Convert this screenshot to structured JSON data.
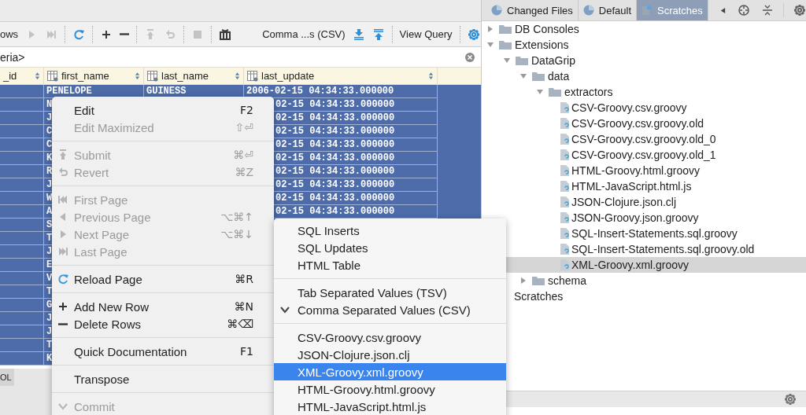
{
  "toolbar": {
    "items": [
      {
        "kind": "text",
        "label": "ows"
      },
      {
        "kind": "next",
        "disabled": true
      },
      {
        "kind": "last",
        "disabled": true
      },
      {
        "kind": "sep"
      },
      {
        "kind": "reload",
        "disabled": false
      },
      {
        "kind": "sep"
      },
      {
        "kind": "add",
        "disabled": false
      },
      {
        "kind": "delete",
        "disabled": false
      },
      {
        "kind": "sep"
      },
      {
        "kind": "submit",
        "disabled": true
      },
      {
        "kind": "revert",
        "disabled": true
      },
      {
        "kind": "sep"
      },
      {
        "kind": "stop",
        "disabled": true
      },
      {
        "kind": "sep"
      },
      {
        "kind": "compare",
        "disabled": false
      },
      {
        "kind": "dropdown",
        "label": "Comma ...s (CSV)"
      },
      {
        "kind": "download",
        "disabled": false
      },
      {
        "kind": "upload",
        "disabled": false
      },
      {
        "kind": "sep"
      },
      {
        "kind": "text",
        "label": "View Query"
      },
      {
        "kind": "sep"
      },
      {
        "kind": "settings",
        "disabled": false
      }
    ]
  },
  "filter": {
    "placeholder": "eria>"
  },
  "table": {
    "columns": [
      "_id",
      "first_name",
      "last_name",
      "last_update"
    ],
    "rows": [
      {
        "selected": true,
        "first_name": "PENELOPE",
        "last_name": "GUINESS",
        "last_update": "2006-02-15 04:34:33.000000"
      },
      {
        "selected": true,
        "first_name": "N",
        "last_update": "02-15 04:34:33.000000"
      },
      {
        "selected": true,
        "first_name": "J",
        "last_update": "02-15 04:34:33.000000"
      },
      {
        "selected": true,
        "first_name": "C",
        "last_update": "02-15 04:34:33.000000"
      },
      {
        "selected": true,
        "first_name": "C",
        "last_update": "02-15 04:34:33.000000"
      },
      {
        "selected": true,
        "first_name": "K",
        "last_update": "02-15 04:34:33.000000"
      },
      {
        "selected": true,
        "first_name": "R",
        "last_update": "02-15 04:34:33.000000"
      },
      {
        "selected": true,
        "first_name": "J",
        "last_update": "02-15 04:34:33.000000"
      },
      {
        "selected": true,
        "first_name": "W",
        "last_update": "02-15 04:34:33.000000"
      },
      {
        "selected": true,
        "first_name": "A",
        "last_update": "02-15 04:34:33.000000"
      },
      {
        "selected": true,
        "first_name": "S"
      },
      {
        "selected": true,
        "first_name": "T"
      },
      {
        "selected": true,
        "first_name": "J"
      },
      {
        "selected": true,
        "first_name": "E"
      },
      {
        "selected": true,
        "first_name": "V"
      },
      {
        "selected": true,
        "first_name": "T"
      },
      {
        "selected": true,
        "first_name": "G"
      },
      {
        "selected": true,
        "first_name": "J"
      },
      {
        "selected": true,
        "first_name": "J"
      },
      {
        "selected": true,
        "first_name": "T"
      },
      {
        "selected": true,
        "first_name": "K"
      }
    ]
  },
  "bottom_tab": {
    "label": "OL"
  },
  "right_panel": {
    "tabs": [
      {
        "label": "Changed Files",
        "selected": false,
        "kind": "changes"
      },
      {
        "label": "Default",
        "selected": false,
        "kind": "changes"
      },
      {
        "label": "Scratches",
        "selected": true,
        "kind": "scratches"
      }
    ],
    "tree": [
      {
        "label": "DB Consoles",
        "kind": "folder",
        "expanded": false
      },
      {
        "label": "Extensions",
        "kind": "folder",
        "expanded": true,
        "children": [
          {
            "label": "DataGrip",
            "kind": "folder",
            "expanded": true,
            "children": [
              {
                "label": "data",
                "kind": "folder",
                "expanded": true,
                "children": [
                  {
                    "label": "extractors",
                    "kind": "folder",
                    "expanded": true,
                    "children": [
                      {
                        "label": "CSV-Groovy.csv.groovy",
                        "kind": "file",
                        "selected": false
                      },
                      {
                        "label": "CSV-Groovy.csv.groovy.old",
                        "kind": "file",
                        "selected": false
                      },
                      {
                        "label": "CSV-Groovy.csv.groovy.old_0",
                        "kind": "file",
                        "selected": false
                      },
                      {
                        "label": "CSV-Groovy.csv.groovy.old_1",
                        "kind": "file",
                        "selected": false
                      },
                      {
                        "label": "HTML-Groovy.html.groovy",
                        "kind": "file",
                        "selected": false
                      },
                      {
                        "label": "HTML-JavaScript.html.js",
                        "kind": "file",
                        "selected": false
                      },
                      {
                        "label": "JSON-Clojure.json.clj",
                        "kind": "file",
                        "selected": false
                      },
                      {
                        "label": "JSON-Groovy.json.groovy",
                        "kind": "file",
                        "selected": false
                      },
                      {
                        "label": "SQL-Insert-Statements.sql.groovy",
                        "kind": "file",
                        "selected": false
                      },
                      {
                        "label": "SQL-Insert-Statements.sql.groovy.old",
                        "kind": "file",
                        "selected": false
                      },
                      {
                        "label": "XML-Groovy.xml.groovy",
                        "kind": "file",
                        "selected": true
                      }
                    ]
                  }
                ]
              },
              {
                "label": "schema",
                "kind": "folder",
                "expanded": false
              }
            ]
          }
        ]
      },
      {
        "label": "Scratches",
        "kind": "plain"
      }
    ]
  },
  "context_menu": {
    "groups": [
      [
        {
          "label": "Edit",
          "shortcut": "F2",
          "kind": "plain",
          "disabled": false
        },
        {
          "label": "Edit Maximized",
          "shortcut": "⇧⏎",
          "kind": "plain",
          "disabled": true
        }
      ],
      [
        {
          "label": "Submit",
          "shortcut": "⌘⏎",
          "kind": "submit",
          "disabled": true
        },
        {
          "label": "Revert",
          "shortcut": "⌘Z",
          "kind": "revert",
          "disabled": true
        }
      ],
      [
        {
          "label": "First Page",
          "kind": "first",
          "disabled": true
        },
        {
          "label": "Previous Page",
          "shortcut": "⌥⌘↑",
          "kind": "previous",
          "disabled": true
        },
        {
          "label": "Next Page",
          "shortcut": "⌥⌘↓",
          "kind": "next",
          "disabled": true
        },
        {
          "label": "Last Page",
          "kind": "last",
          "disabled": true
        }
      ],
      [
        {
          "label": "Reload Page",
          "shortcut": "⌘R",
          "kind": "reload",
          "disabled": false
        }
      ],
      [
        {
          "label": "Add New Row",
          "shortcut": "⌘N",
          "kind": "add",
          "disabled": false
        },
        {
          "label": "Delete Rows",
          "shortcut": "⌘⌫",
          "kind": "delete",
          "disabled": false
        }
      ],
      [
        {
          "label": "Quick Documentation",
          "shortcut": "F1",
          "kind": "plain",
          "disabled": false
        }
      ],
      [
        {
          "label": "Transpose",
          "kind": "plain",
          "disabled": false
        }
      ],
      [
        {
          "label": "Commit",
          "kind": "check",
          "disabled": true
        }
      ]
    ]
  },
  "export_menu": {
    "groups": [
      [
        {
          "label": "SQL Inserts",
          "checked": false,
          "selected": false
        },
        {
          "label": "SQL Updates",
          "checked": false,
          "selected": false
        },
        {
          "label": "HTML Table",
          "checked": false,
          "selected": false
        }
      ],
      [
        {
          "label": "Tab Separated Values (TSV)",
          "checked": false,
          "selected": false
        },
        {
          "label": "Comma Separated Values (CSV)",
          "checked": true,
          "selected": false
        }
      ],
      [
        {
          "label": "CSV-Groovy.csv.groovy",
          "checked": false,
          "selected": false
        },
        {
          "label": "JSON-Clojure.json.clj",
          "checked": false,
          "selected": false
        },
        {
          "label": "XML-Groovy.xml.groovy",
          "checked": false,
          "selected": true
        },
        {
          "label": "HTML-Groovy.html.groovy",
          "checked": false,
          "selected": false
        },
        {
          "label": "HTML-JavaScript.html.js",
          "checked": false,
          "selected": false
        }
      ]
    ]
  }
}
